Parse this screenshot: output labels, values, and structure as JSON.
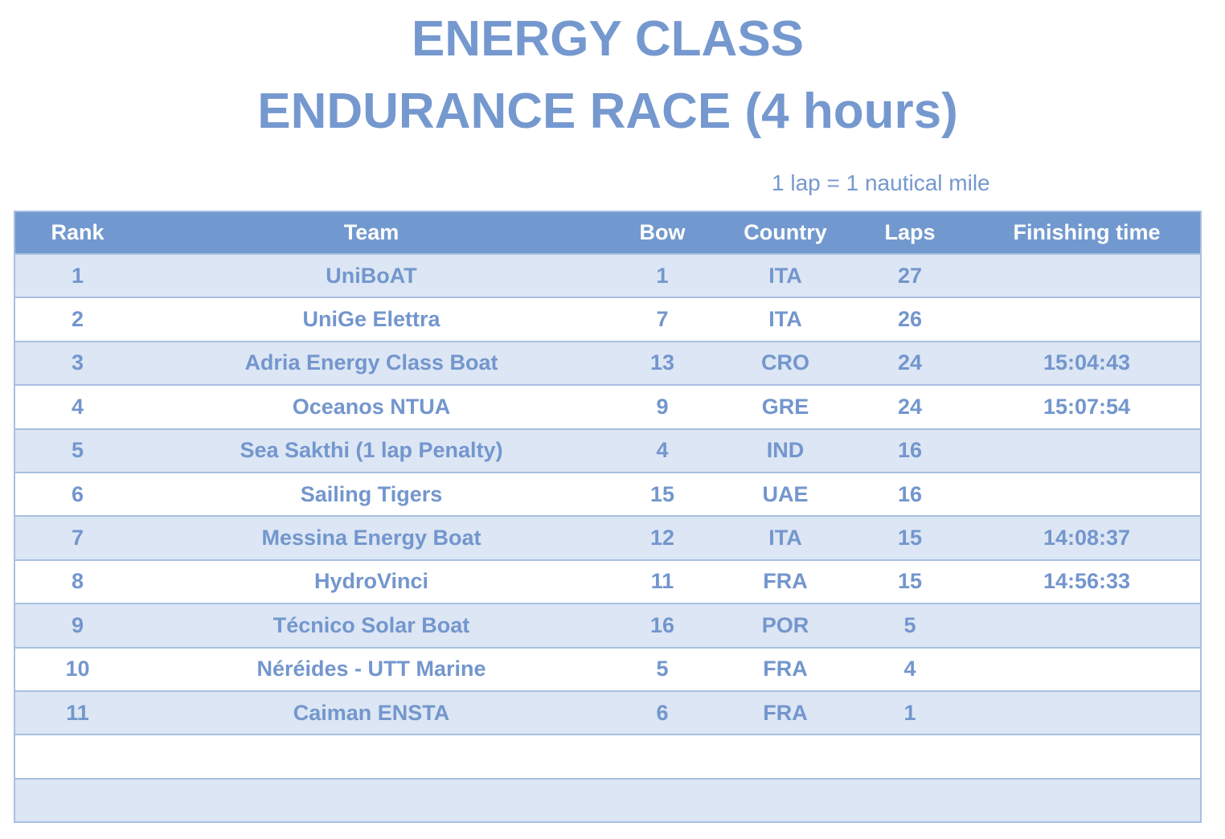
{
  "title": {
    "line1": "ENERGY CLASS",
    "line2": "ENDURANCE RACE (4 hours)"
  },
  "note": "1 lap =  1 nautical mile",
  "columns": {
    "rank": "Rank",
    "team": "Team",
    "bow": "Bow",
    "country": "Country",
    "laps": "Laps",
    "time": "Finishing time"
  },
  "rows": [
    {
      "rank": "1",
      "team": "UniBoAT",
      "bow": "1",
      "country": "ITA",
      "laps": "27",
      "time": ""
    },
    {
      "rank": "2",
      "team": "UniGe Elettra",
      "bow": "7",
      "country": "ITA",
      "laps": "26",
      "time": ""
    },
    {
      "rank": "3",
      "team": "Adria Energy Class Boat",
      "bow": "13",
      "country": "CRO",
      "laps": "24",
      "time": "15:04:43"
    },
    {
      "rank": "4",
      "team": "Oceanos NTUA",
      "bow": "9",
      "country": "GRE",
      "laps": "24",
      "time": "15:07:54"
    },
    {
      "rank": "5",
      "team": "Sea Sakthi (1 lap Penalty)",
      "bow": "4",
      "country": "IND",
      "laps": "16",
      "time": ""
    },
    {
      "rank": "6",
      "team": "Sailing Tigers",
      "bow": "15",
      "country": "UAE",
      "laps": "16",
      "time": ""
    },
    {
      "rank": "7",
      "team": "Messina Energy Boat",
      "bow": "12",
      "country": "ITA",
      "laps": "15",
      "time": "14:08:37"
    },
    {
      "rank": "8",
      "team": "HydroVinci",
      "bow": "11",
      "country": "FRA",
      "laps": "15",
      "time": "14:56:33"
    },
    {
      "rank": "9",
      "team": "Técnico Solar Boat",
      "bow": "16",
      "country": "POR",
      "laps": "5",
      "time": ""
    },
    {
      "rank": "10",
      "team": "Néréides - UTT Marine",
      "bow": "5",
      "country": "FRA",
      "laps": "4",
      "time": ""
    },
    {
      "rank": "11",
      "team": "Caiman ENSTA",
      "bow": "6",
      "country": "FRA",
      "laps": "1",
      "time": ""
    },
    {
      "rank": "",
      "team": "",
      "bow": "",
      "country": "",
      "laps": "",
      "time": ""
    },
    {
      "rank": "",
      "team": "",
      "bow": "",
      "country": "",
      "laps": "",
      "time": ""
    }
  ],
  "colors": {
    "accent": "#7598cf",
    "header_bg": "#7299cf",
    "row_shaded": "#dce6f4",
    "border": "#a8bfe0"
  }
}
